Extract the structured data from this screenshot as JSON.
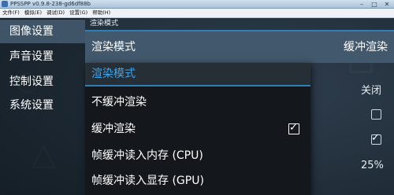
{
  "window": {
    "title": "PPSSPP v0.9.8-238-gd6df88b",
    "controls": {
      "minimize": "–",
      "maximize": "□",
      "close": "✕"
    }
  },
  "menubar": {
    "items": [
      "文件(F)",
      "模拟(E)",
      "调试(D)",
      "设置(G)",
      "帮助(H)"
    ]
  },
  "sidebar": {
    "items": [
      {
        "label": "图像设置",
        "active": true
      },
      {
        "label": "声音设置",
        "active": false
      },
      {
        "label": "控制设置",
        "active": false
      },
      {
        "label": "系统设置",
        "active": false
      }
    ]
  },
  "content": {
    "section_title": "渲染模式",
    "setting": {
      "label": "渲染模式",
      "value": "缓冲渲染"
    },
    "background": {
      "value_off": "关闭",
      "value_percent": "25%",
      "checkbox_1_checked": false,
      "checkbox_2_checked": true
    }
  },
  "popup": {
    "title": "渲染模式",
    "options": [
      {
        "label": "不缓冲渲染",
        "selected": false
      },
      {
        "label": "缓冲渲染",
        "selected": true
      },
      {
        "label": "帧缓冲读入内存 (CPU)",
        "selected": false
      },
      {
        "label": "帧缓冲读入显存 (GPU)",
        "selected": false
      }
    ],
    "check_glyph": "✓"
  },
  "colors": {
    "accent": "#2e7fb5",
    "popup_title": "#3ea6ee",
    "selected_row": "#42586c",
    "popup_bg": "#14181c"
  }
}
